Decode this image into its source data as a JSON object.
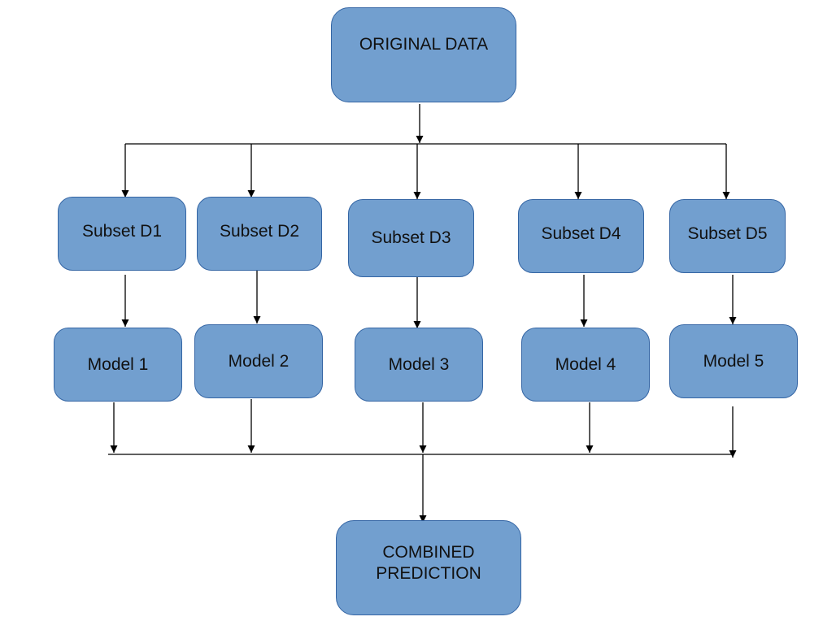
{
  "diagram": {
    "colors": {
      "node_fill": "#729fcf",
      "node_border": "#3465a4",
      "edge": "#000000",
      "text": "#111111"
    },
    "source": {
      "id": "original",
      "label": "ORIGINAL DATA"
    },
    "subsets": [
      {
        "id": "d1",
        "label": "Subset D1"
      },
      {
        "id": "d2",
        "label": "Subset D2"
      },
      {
        "id": "d3",
        "label": "Subset D3"
      },
      {
        "id": "d4",
        "label": "Subset D4"
      },
      {
        "id": "d5",
        "label": "Subset D5"
      }
    ],
    "models": [
      {
        "id": "m1",
        "label": "Model 1"
      },
      {
        "id": "m2",
        "label": "Model 2"
      },
      {
        "id": "m3",
        "label": "Model 3"
      },
      {
        "id": "m4",
        "label": "Model 4"
      },
      {
        "id": "m5",
        "label": "Model 5"
      }
    ],
    "sink": {
      "id": "combined",
      "label": "COMBINED\nPREDICTION"
    },
    "edges": [
      [
        "original",
        "d1"
      ],
      [
        "original",
        "d2"
      ],
      [
        "original",
        "d3"
      ],
      [
        "original",
        "d4"
      ],
      [
        "original",
        "d5"
      ],
      [
        "d1",
        "m1"
      ],
      [
        "d2",
        "m2"
      ],
      [
        "d3",
        "m3"
      ],
      [
        "d4",
        "m4"
      ],
      [
        "d5",
        "m5"
      ],
      [
        "m1",
        "combined"
      ],
      [
        "m2",
        "combined"
      ],
      [
        "m3",
        "combined"
      ],
      [
        "m4",
        "combined"
      ],
      [
        "m5",
        "combined"
      ]
    ]
  }
}
